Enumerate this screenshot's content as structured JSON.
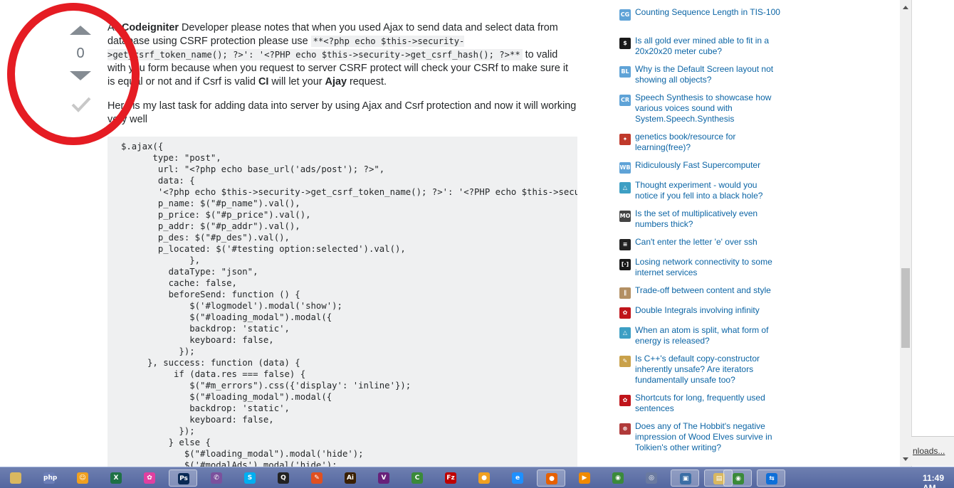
{
  "answer": {
    "vote_count": "0",
    "para1": {
      "t1": "All ",
      "b1": "Codeigniter",
      "t2": " Developer please notes that when you used Ajax to send data and select data from database using CSRF protection please use ",
      "code": "**<?php echo $this->security->get_csrf_token_name(); ?>': '<?PHP echo $this->security->get_csrf_hash(); ?>**",
      "t3": " to valid with you form because when you request to server CSRF protect will check your CSRf to make sure it is equal or not and if Csrf is valid ",
      "b2": "CI",
      "t4": " will let your ",
      "b3": "Ajay",
      "t5": " request."
    },
    "para2": "Here is my last task for adding data into server by using Ajax and Csrf protection and now it will working very well",
    "code_lines": [
      "$.ajax({",
      "      type: \"post\",",
      "       url: \"<?php echo base_url('ads/post'); ?>\",",
      "       data: {",
      "       '<?php echo $this->security->get_csrf_token_name(); ?>': '<?PHP echo $this->security->get_csrf_hash(); ?>',",
      "       p_name: $(\"#p_name\").val(),",
      "       p_price: $(\"#p_price\").val(),",
      "       p_addr: $(\"#p_addr\").val(),",
      "       p_des: $(\"#p_des\").val(),",
      "       p_located: $('#testing option:selected').val(),",
      "             },",
      "         dataType: \"json\",",
      "         cache: false,",
      "         beforeSend: function () {",
      "             $('#logmodel').modal('show');",
      "             $(\"#loading_modal\").modal({",
      "             backdrop: 'static',",
      "             keyboard: false,",
      "           });",
      "     }, success: function (data) {",
      "          if (data.res === false) {",
      "             $(\"#m_errors\").css({'display': 'inline'});",
      "             $(\"#loading_modal\").modal({",
      "             backdrop: 'static',",
      "             keyboard: false,",
      "           });",
      "         } else {",
      "            $(\"#loading_modal\").modal('hide');",
      "            $('#modalAds').modal('hide');"
    ]
  },
  "hot_network_questions": [
    {
      "title": "Counting Sequence Length in TIS-100",
      "icon": "codegolf-icon",
      "color": "#5fa3d7",
      "abbr": "CG"
    },
    {
      "title": "Is all gold ever mined able to fit in a 20x20x20 meter cube?",
      "icon": "money-icon",
      "color": "#1a1a1a",
      "abbr": "$"
    },
    {
      "title": "Why is the Default Screen layout not showing all objects?",
      "icon": "blender-icon",
      "color": "#5fa3d7",
      "abbr": "BL"
    },
    {
      "title": "Speech Synthesis to showcase how various voices sound with System.Speech.Synthesis",
      "icon": "codereview-icon",
      "color": "#5fa3d7",
      "abbr": "CR"
    },
    {
      "title": "genetics book/resource for learning(free)?",
      "icon": "biology-icon",
      "color": "#c0392b",
      "abbr": "✦"
    },
    {
      "title": "Ridiculously Fast Supercomputer",
      "icon": "worldbuilding-icon",
      "color": "#5fa3d7",
      "abbr": "WB"
    },
    {
      "title": "Thought experiment - would you notice if you fell into a black hole?",
      "icon": "physics-icon",
      "color": "#3d9fc4",
      "abbr": "△"
    },
    {
      "title": "Is the set of multiplicatively even numbers thick?",
      "icon": "mathoverflow-icon",
      "color": "#444444",
      "abbr": "MO"
    },
    {
      "title": "Can't enter the letter 'e' over ssh",
      "icon": "unix-icon",
      "color": "#222222",
      "abbr": "≡"
    },
    {
      "title": "Losing network connectivity to some internet services",
      "icon": "serverfault-icon",
      "color": "#1a1a1a",
      "abbr": "[·]"
    },
    {
      "title": "Trade-off between content and style",
      "icon": "writing-icon",
      "color": "#b38f63",
      "abbr": "∥"
    },
    {
      "title": "Double Integrals involving infinity",
      "icon": "math-icon",
      "color": "#c0141a",
      "abbr": "✿"
    },
    {
      "title": "When an atom is split, what form of energy is released?",
      "icon": "physics-icon",
      "color": "#3d9fc4",
      "abbr": "△"
    },
    {
      "title": "Is C++'s default copy-constructor inherently unsafe? Are iterators fundamentally unsafe too?",
      "icon": "softwareengineering-icon",
      "color": "#c9a14a",
      "abbr": "✎"
    },
    {
      "title": "Shortcuts for long, frequently used sentences",
      "icon": "english-icon",
      "color": "#c0141a",
      "abbr": "✿"
    },
    {
      "title": "Does any of The Hobbit's negative impression of Wood Elves survive in Tolkien's other writing?",
      "icon": "scifi-icon",
      "color": "#b03a3a",
      "abbr": "⊛"
    }
  ],
  "downloads_label": "nloads...",
  "taskbar": {
    "clock": "11:49 AM",
    "apps": [
      {
        "name": "file-explorer-icon",
        "color": "#d9b860",
        "abbr": ""
      },
      {
        "name": "php-icon",
        "color": "#6c7eb7",
        "abbr": "php"
      },
      {
        "name": "emoji-app-icon",
        "color": "#f0a020",
        "abbr": "☺"
      },
      {
        "name": "excel-icon",
        "color": "#1e7145",
        "abbr": "X"
      },
      {
        "name": "flower-app-icon",
        "color": "#e040a0",
        "abbr": "✿"
      },
      {
        "name": "photoshop-icon",
        "color": "#0a2a55",
        "abbr": "Ps"
      },
      {
        "name": "viber-icon",
        "color": "#7b519d",
        "abbr": "✆"
      },
      {
        "name": "skype-icon",
        "color": "#00aff0",
        "abbr": "S"
      },
      {
        "name": "qq-icon",
        "color": "#222222",
        "abbr": "Q"
      },
      {
        "name": "paint-icon",
        "color": "#e05020",
        "abbr": "✎"
      },
      {
        "name": "illustrator-icon",
        "color": "#3a2000",
        "abbr": "Ai"
      },
      {
        "name": "visual-studio-icon",
        "color": "#68217a",
        "abbr": "V"
      },
      {
        "name": "camtasia-icon",
        "color": "#3a8a3a",
        "abbr": "C"
      },
      {
        "name": "filezilla-icon",
        "color": "#bf0000",
        "abbr": "Fz"
      },
      {
        "name": "media-icon",
        "color": "#f0a020",
        "abbr": "●"
      },
      {
        "name": "internet-explorer-icon",
        "color": "#1e90ff",
        "abbr": "e"
      },
      {
        "name": "firefox-icon",
        "color": "#e66000",
        "abbr": "●"
      },
      {
        "name": "player-icon",
        "color": "#f08a00",
        "abbr": "▶"
      },
      {
        "name": "chrome-icon",
        "color": "#3a8a3a",
        "abbr": "◉"
      },
      {
        "name": "app-icon",
        "color": "#6a7aa0",
        "abbr": "◎"
      },
      {
        "name": "virtualbox-icon",
        "color": "#3a6ea5",
        "abbr": "▣"
      },
      {
        "name": "folder-app-icon",
        "color": "#d9b860",
        "abbr": "▤"
      },
      {
        "name": "chrome-active-icon",
        "color": "#3a8a3a",
        "abbr": "◉"
      },
      {
        "name": "teamviewer-icon",
        "color": "#0e6fd8",
        "abbr": "⇆"
      }
    ]
  }
}
